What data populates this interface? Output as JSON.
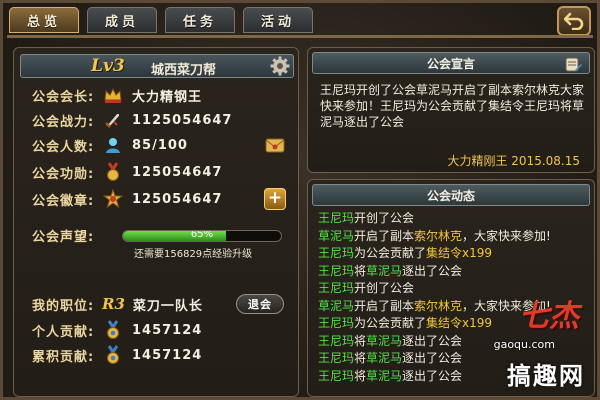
{
  "tabs": [
    {
      "label": "总览",
      "active": true
    },
    {
      "label": "成员",
      "active": false
    },
    {
      "label": "任务",
      "active": false
    },
    {
      "label": "活动",
      "active": false
    }
  ],
  "guild": {
    "level": "Lv3",
    "name": "城西菜刀帮"
  },
  "stats": {
    "leader_label": "公会会长:",
    "leader_value": "大力精钢王",
    "power_label": "公会战力:",
    "power_value": "1125054647",
    "members_label": "公会人数:",
    "members_value": "85/100",
    "merit_label": "公会功勋:",
    "merit_value": "125054647",
    "badge_label": "公会徽章:",
    "badge_value": "125054647",
    "prestige_label": "公会声望:",
    "prestige_percent": "65%",
    "prestige_fraction": 0.65,
    "exp_note": "还需要156829点经验升级",
    "position_label": "我的职位:",
    "position_rank": "R3",
    "position_value": "菜刀一队长",
    "quit_label": "退会",
    "personal_label": "个人贡献:",
    "personal_value": "1457124",
    "total_label": "累积贡献:",
    "total_value": "1457124"
  },
  "declaration": {
    "title": "公会宣言",
    "text": "王尼玛开创了公会草泥马开启了副本索尔林克大家快来参加！王尼玛为公会贡献了集结令王尼玛将草泥马逐出了公会",
    "signature": "大力精刚王  2015.08.15"
  },
  "news": {
    "title": "公会动态",
    "lines": [
      {
        "a": "王尼玛",
        "b": "开创了公会",
        "c": "",
        "d": ""
      },
      {
        "a": "草泥马",
        "b": "开启了副本",
        "c": "索尔林克",
        "d": "，大家快来参加!"
      },
      {
        "a": "王尼玛",
        "b": "为公会贡献了",
        "c": "集结令x199",
        "d": ""
      },
      {
        "a": "王尼玛",
        "b": "将",
        "c": "草泥马",
        "d": "逐出了公会"
      },
      {
        "a": "王尼玛",
        "b": "开创了公会",
        "c": "",
        "d": ""
      },
      {
        "a": "草泥马",
        "b": "开启了副本",
        "c": "索尔林克",
        "d": "，大家快来参加!"
      },
      {
        "a": "王尼玛",
        "b": "为公会贡献了",
        "c": "集结令x199",
        "d": ""
      },
      {
        "a": "王尼玛",
        "b": "将",
        "c": "草泥马",
        "d": "逐出了公会"
      },
      {
        "a": "王尼玛",
        "b": "将",
        "c": "草泥马",
        "d": "逐出了公会"
      },
      {
        "a": "王尼玛",
        "b": "将",
        "c": "草泥马",
        "d": "逐出了公会"
      }
    ]
  },
  "watermark": {
    "logo": "七杰",
    "site": "gaoqu.com",
    "brand": "搞趣网"
  },
  "colors": {
    "accent_gold": "#f0c64e",
    "name_green": "#55e04a",
    "highlight_yellow": "#f2c83a",
    "progress_green": "#4fbf35"
  }
}
